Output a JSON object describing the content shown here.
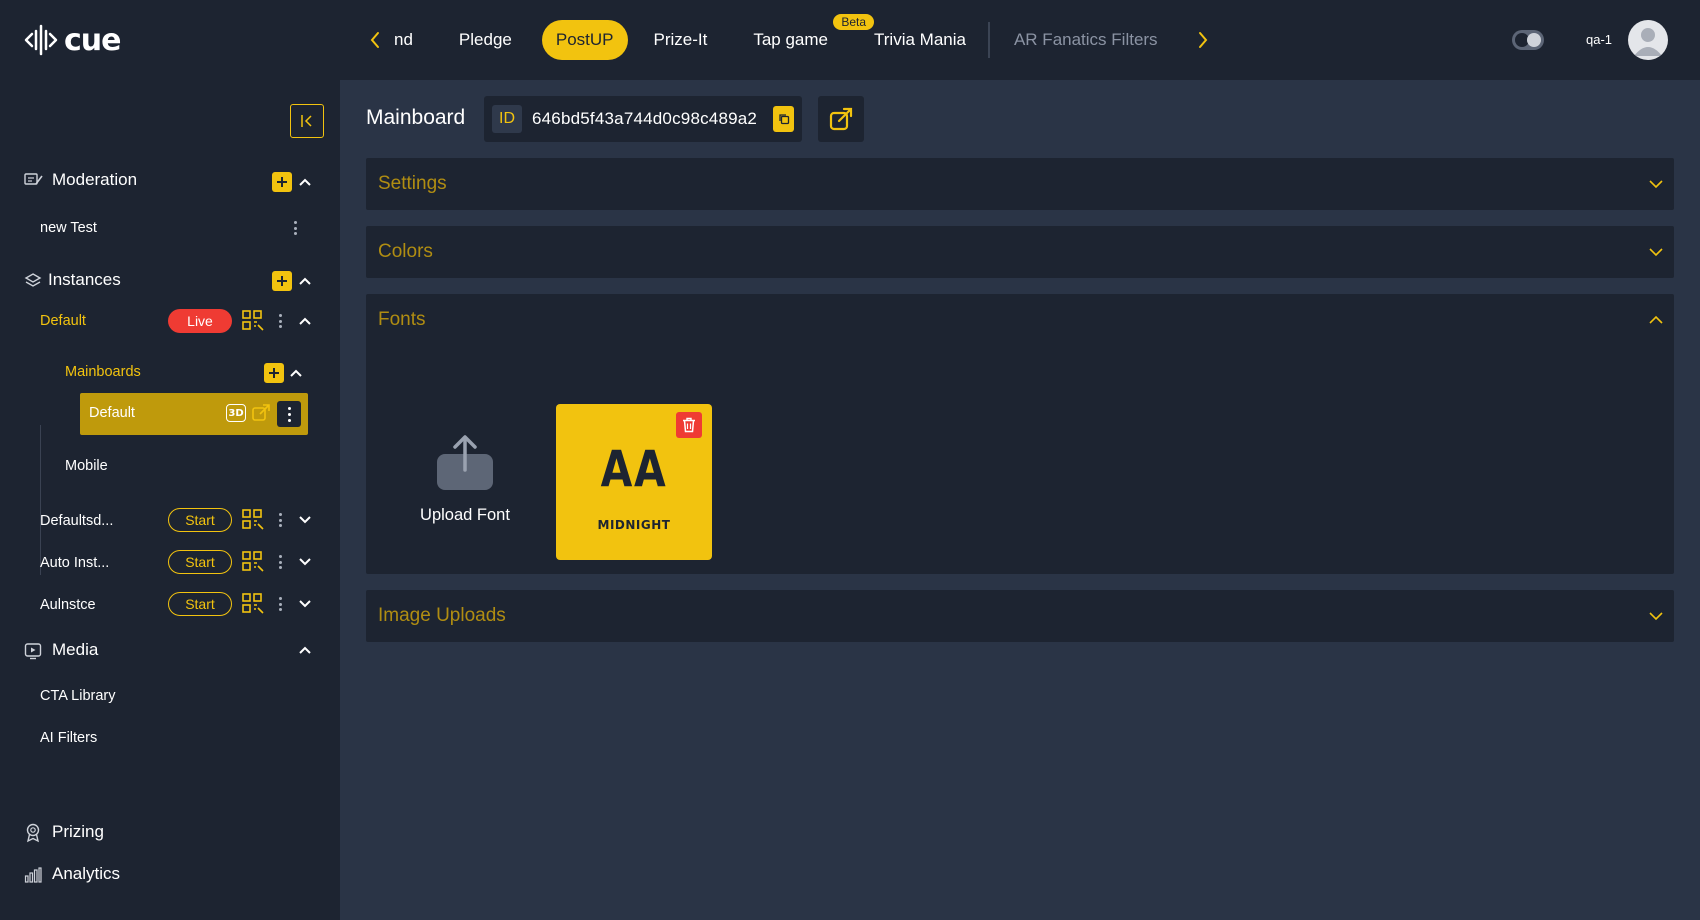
{
  "app": {
    "logo_text": "cue"
  },
  "topnav": {
    "tabs": [
      {
        "label": "nd"
      },
      {
        "label": "Pledge"
      },
      {
        "label": "PostUP",
        "active": true
      },
      {
        "label": "Prize-It"
      },
      {
        "label": "Tap game",
        "badge": "Beta"
      },
      {
        "label": "Trivia Mania"
      },
      {
        "label": "AR Fanatics Filters"
      }
    ],
    "user": "qa-1"
  },
  "sidebar": {
    "moderation": {
      "label": "Moderation",
      "items": [
        {
          "label": "new Test"
        }
      ]
    },
    "instances": {
      "label": "Instances",
      "items": [
        {
          "label": "Default",
          "status": "Live",
          "mainboards": {
            "label": "Mainboards",
            "items": [
              {
                "label": "Default",
                "badge": "3D"
              }
            ]
          },
          "mobile": {
            "label": "Mobile"
          }
        },
        {
          "label": "Defaultsd...",
          "status": "Start"
        },
        {
          "label": "Auto Inst...",
          "status": "Start"
        },
        {
          "label": "Aulnstce",
          "status": "Start"
        }
      ]
    },
    "media": {
      "label": "Media",
      "items": [
        {
          "label": "CTA Library"
        },
        {
          "label": "AI Filters"
        }
      ]
    },
    "prizing": {
      "label": "Prizing"
    },
    "analytics": {
      "label": "Analytics"
    }
  },
  "main": {
    "title": "Mainboard",
    "id_tag": "ID",
    "id_value": "646bd5f43a744d0c98c489a2",
    "panels": {
      "settings": "Settings",
      "colors": "Colors",
      "fonts": "Fonts",
      "image_uploads": "Image Uploads"
    },
    "fonts": {
      "upload_label": "Upload Font",
      "cards": [
        {
          "preview": "AA",
          "name": "MIDNIGHT"
        }
      ]
    }
  },
  "colors": {
    "accent": "#f2c30f",
    "live": "#ef3b33",
    "bg_dark": "#1d2431",
    "bg_main": "#2a3446"
  }
}
